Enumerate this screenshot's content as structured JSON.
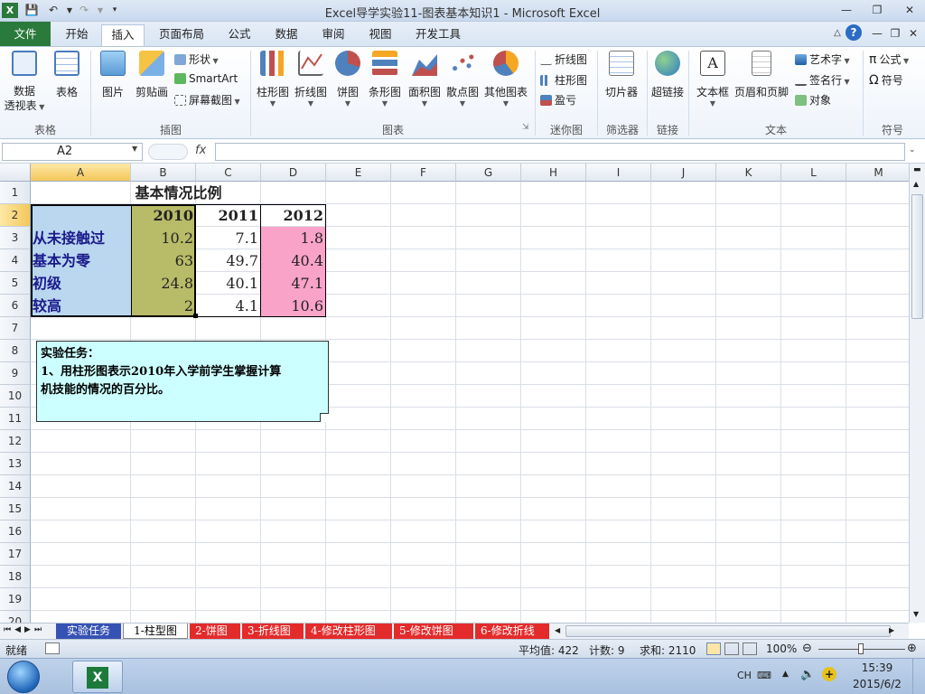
{
  "window": {
    "title": "Excel导学实验11-图表基本知识1 - Microsoft Excel"
  },
  "tabs": [
    "文件",
    "开始",
    "插入",
    "页面布局",
    "公式",
    "数据",
    "审阅",
    "视图",
    "开发工具"
  ],
  "ribbon": {
    "groups": {
      "tables": "表格",
      "illustrations": "插图",
      "charts": "图表",
      "sparklines": "迷你图",
      "filter": "筛选器",
      "links": "链接",
      "text": "文本",
      "symbols": "符号"
    },
    "pivot": "数据\n透视表",
    "pivot_l1": "数据",
    "pivot_l2": "透视表",
    "table": "表格",
    "picture": "图片",
    "clipart": "剪贴画",
    "shapes": "形状",
    "smartart": "SmartArt",
    "screenshot": "屏幕截图",
    "charts": [
      "柱形图",
      "折线图",
      "饼图",
      "条形图",
      "面积图",
      "散点图",
      "其他图表"
    ],
    "spark_line": "折线图",
    "spark_column": "柱形图",
    "spark_winloss": "盈亏",
    "slicer": "切片器",
    "hyperlink": "超链接",
    "textbox": "文本框",
    "header_footer": "页眉和页脚",
    "wordart": "艺术字",
    "signature": "签名行",
    "object": "对象",
    "equation": "公式",
    "symbol": "符号"
  },
  "formula_bar": {
    "name_box": "A2",
    "fx": "fx",
    "value": ""
  },
  "columns": [
    "A",
    "B",
    "C",
    "D",
    "E",
    "F",
    "G",
    "H",
    "I",
    "J",
    "K",
    "L",
    "M"
  ],
  "rows": [
    "1",
    "2",
    "3",
    "4",
    "5",
    "6",
    "7",
    "8",
    "9",
    "10",
    "11",
    "12",
    "13",
    "14",
    "15",
    "16",
    "17",
    "18",
    "19",
    "20"
  ],
  "sheet": {
    "title": "基本情况比例",
    "years": [
      "2010",
      "2011",
      "2012"
    ],
    "labels": [
      "从未接触过",
      "基本为零",
      "初级",
      "较高"
    ],
    "b": [
      "10.2",
      "63",
      "24.8",
      "2"
    ],
    "c": [
      "7.1",
      "49.7",
      "40.1",
      "4.1"
    ],
    "d": [
      "1.8",
      "40.4",
      "47.1",
      "10.6"
    ]
  },
  "note": {
    "line1": "实验任务：",
    "line2": "1、用柱形图表示2010年入学前学生掌握计算",
    "line3": "机技能的情况的百分比。"
  },
  "sheet_tabs": [
    "实验任务",
    "1-柱型图",
    "2-饼图",
    "3-折线图",
    "4-修改柱形图",
    "5-修改饼图",
    "6-修改折线"
  ],
  "status": {
    "ready": "就绪",
    "average": "平均值: 422",
    "count": "计数: 9",
    "sum": "求和: 2110",
    "zoom": "100%"
  },
  "taskbar": {
    "lang": "CH",
    "time": "15:39",
    "date": "2015/6/2"
  },
  "colors": {
    "b_fill": "#b8bb68",
    "d_fill": "#f9a3c9",
    "label_fill": "#bad7ef",
    "note_fill": "#ccffff",
    "label_text": "#1a1a8c",
    "file_tab": "#2a7a3b"
  }
}
